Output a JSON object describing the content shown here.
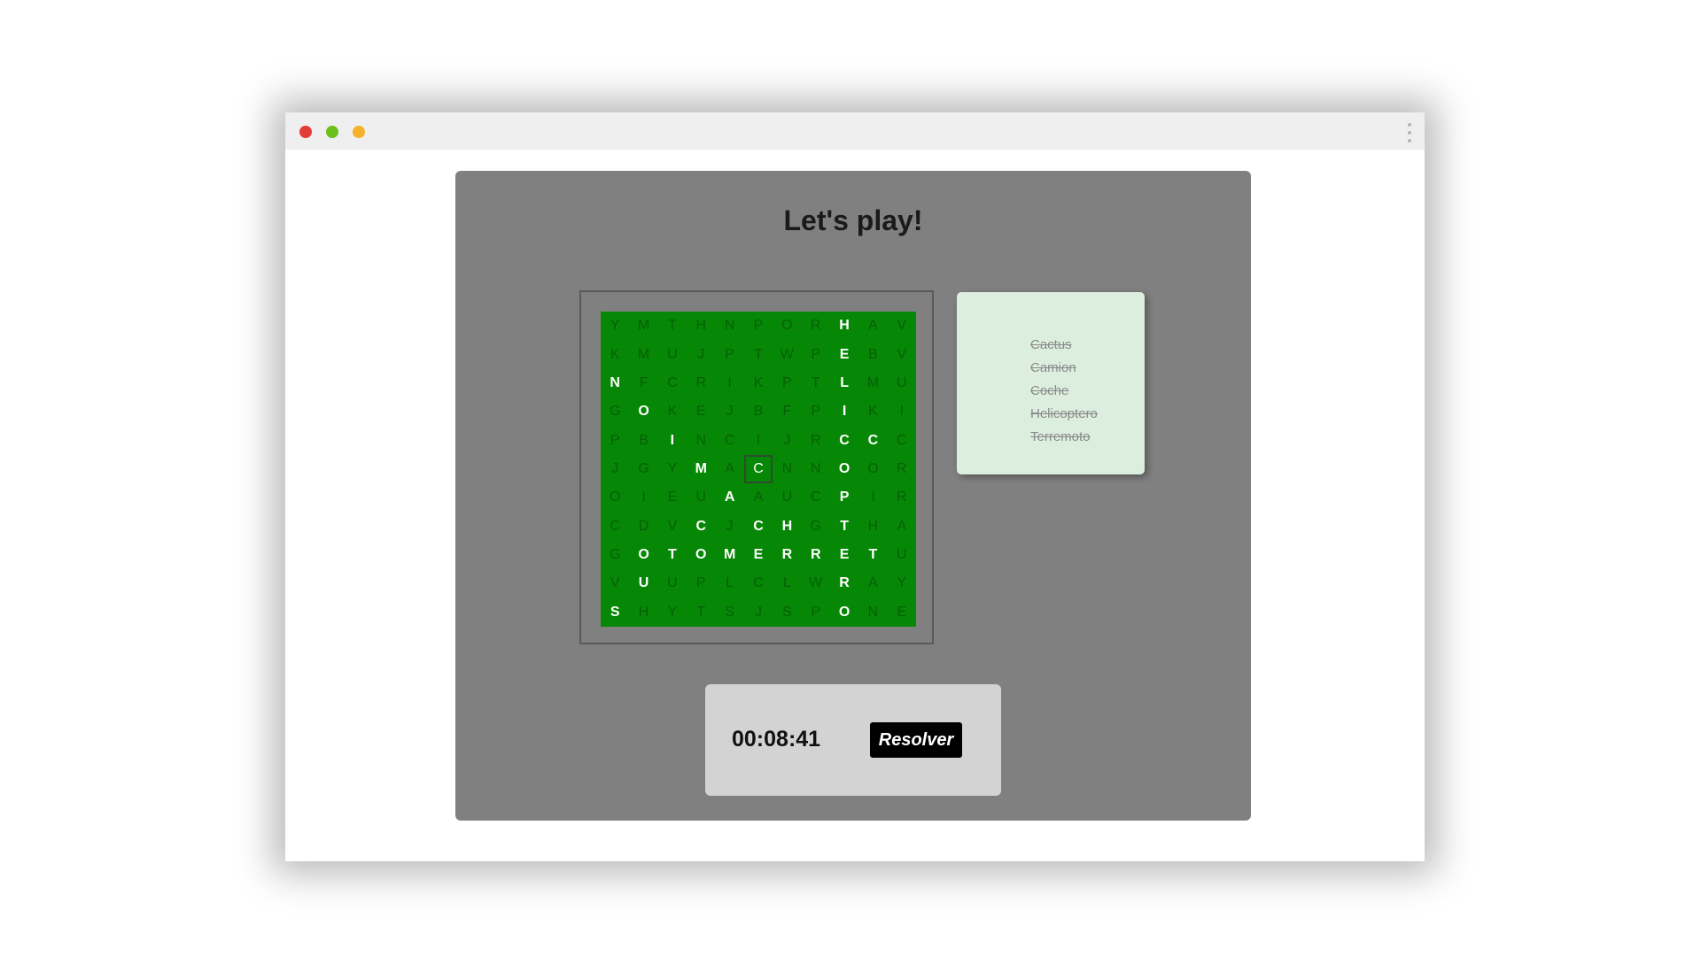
{
  "window": {
    "controls": [
      "close",
      "minimize",
      "maximize"
    ],
    "menu_icon": "kebab-menu-icon"
  },
  "game": {
    "title": "Let's play!",
    "grid": [
      [
        "Y",
        "M",
        "T",
        "H",
        "N",
        "P",
        "O",
        "R",
        "H",
        "A",
        "V"
      ],
      [
        "K",
        "M",
        "U",
        "J",
        "P",
        "T",
        "W",
        "P",
        "E",
        "B",
        "V"
      ],
      [
        "N",
        "F",
        "C",
        "R",
        "I",
        "K",
        "P",
        "T",
        "L",
        "M",
        "U"
      ],
      [
        "G",
        "O",
        "K",
        "E",
        "J",
        "B",
        "F",
        "P",
        "I",
        "K",
        "I"
      ],
      [
        "P",
        "B",
        "I",
        "N",
        "C",
        "I",
        "J",
        "R",
        "C",
        "C",
        "C"
      ],
      [
        "J",
        "G",
        "Y",
        "M",
        "A",
        "C",
        "N",
        "N",
        "O",
        "O",
        "R"
      ],
      [
        "O",
        "I",
        "E",
        "U",
        "A",
        "A",
        "U",
        "C",
        "P",
        "I",
        "R"
      ],
      [
        "C",
        "D",
        "V",
        "C",
        "J",
        "C",
        "H",
        "G",
        "T",
        "H",
        "A"
      ],
      [
        "G",
        "O",
        "T",
        "O",
        "M",
        "E",
        "R",
        "R",
        "E",
        "T",
        "U"
      ],
      [
        "V",
        "U",
        "U",
        "P",
        "L",
        "C",
        "L",
        "W",
        "R",
        "A",
        "Y"
      ],
      [
        "S",
        "H",
        "Y",
        "T",
        "S",
        "J",
        "S",
        "P",
        "O",
        "N",
        "E"
      ]
    ],
    "found_cells": [
      [
        0,
        8
      ],
      [
        1,
        8
      ],
      [
        2,
        8
      ],
      [
        3,
        8
      ],
      [
        2,
        0
      ],
      [
        3,
        1
      ],
      [
        4,
        2
      ],
      [
        4,
        8
      ],
      [
        4,
        9
      ],
      [
        5,
        3
      ],
      [
        5,
        8
      ],
      [
        6,
        4
      ],
      [
        6,
        8
      ],
      [
        7,
        3
      ],
      [
        7,
        5
      ],
      [
        7,
        6
      ],
      [
        7,
        8
      ],
      [
        8,
        1
      ],
      [
        8,
        2
      ],
      [
        8,
        3
      ],
      [
        8,
        4
      ],
      [
        8,
        5
      ],
      [
        8,
        6
      ],
      [
        8,
        7
      ],
      [
        8,
        8
      ],
      [
        8,
        9
      ],
      [
        9,
        1
      ],
      [
        9,
        8
      ],
      [
        10,
        0
      ],
      [
        10,
        8
      ]
    ],
    "selected_cell": [
      5,
      5
    ],
    "words": [
      "Cactus",
      "Camion",
      "Coche",
      "Helicoptero",
      "Terremoto"
    ],
    "timer": "00:08:41",
    "resolve_label": "Resolver"
  },
  "colors": {
    "grid_background": "#068806",
    "found_letter": "#ffffff",
    "panel": "#808080",
    "word_card": "#dcefdf"
  }
}
